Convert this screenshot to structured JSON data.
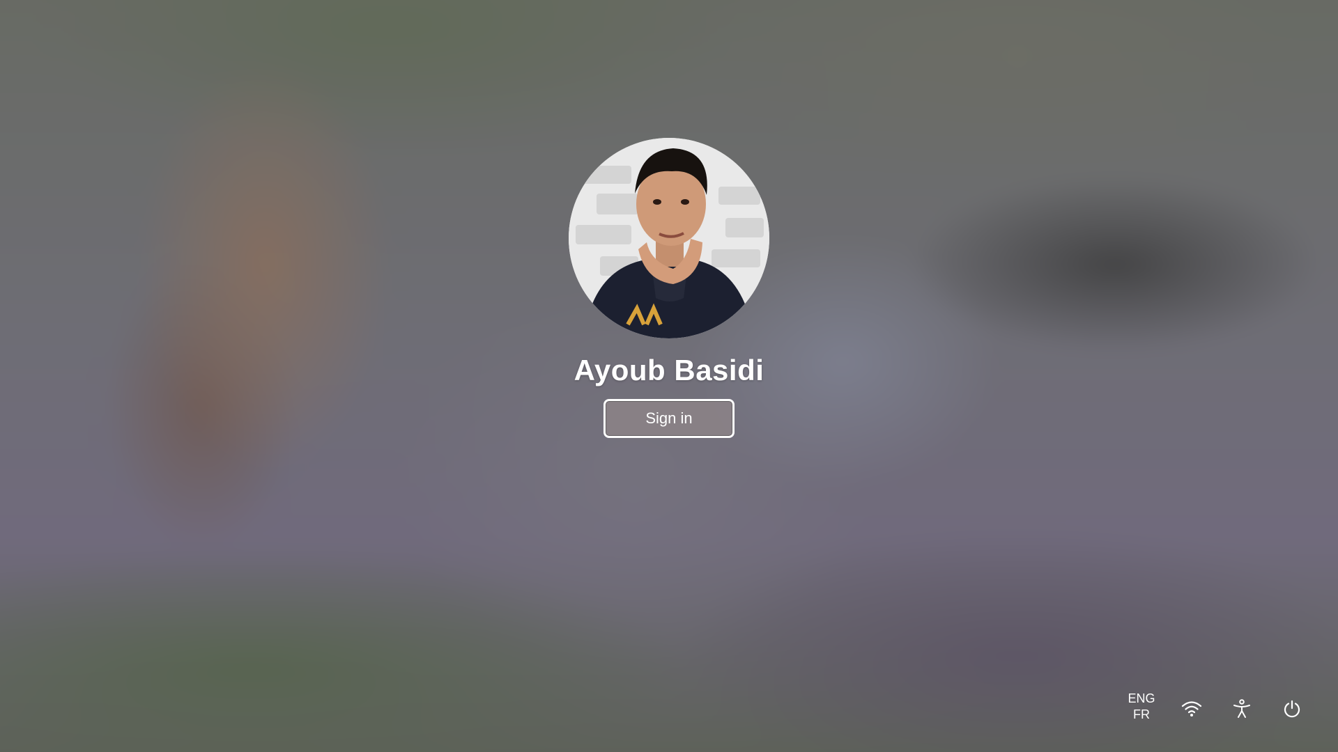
{
  "user": {
    "name": "Ayoub Basidi"
  },
  "signin": {
    "label": "Sign in"
  },
  "tray": {
    "language_primary": "ENG",
    "language_secondary": "FR",
    "icons": [
      "wifi-icon",
      "accessibility-icon",
      "power-icon"
    ]
  },
  "colors": {
    "text": "#ffffff",
    "button_bg": "#8c8287",
    "button_border": "#ffffff"
  }
}
